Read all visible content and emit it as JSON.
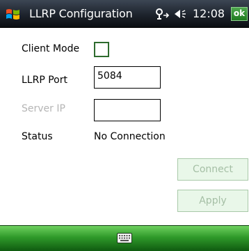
{
  "titlebar": {
    "title": "LLRP Configuration",
    "time": "12:08",
    "ok_label": "ok",
    "icons": [
      "windows-start-icon",
      "connectivity-icon",
      "volume-icon"
    ]
  },
  "form": {
    "client_mode_label": "Client Mode",
    "client_mode_checked": false,
    "llrp_port_label": "LLRP Port",
    "llrp_port_value": "5084",
    "server_ip_label": "Server IP",
    "server_ip_value": "",
    "status_label": "Status",
    "status_value": "No Connection"
  },
  "buttons": {
    "connect": "Connect",
    "apply": "Apply"
  },
  "bottombar": {
    "icon": "keyboard-icon"
  },
  "colors": {
    "titlebar": "#1d232c",
    "ok_green": "#2e8b2e",
    "bottombar_green": "#2f9a2a",
    "disabled_text": "#b5b5b5",
    "button_bg": "#e9f7e9"
  }
}
